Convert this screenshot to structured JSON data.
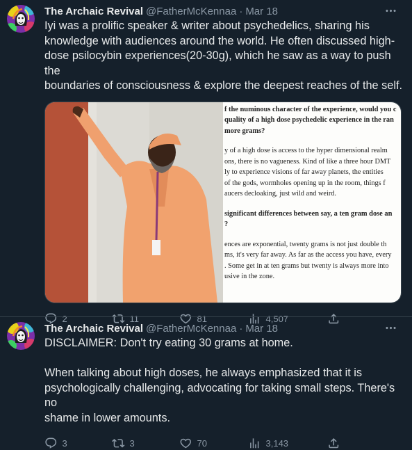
{
  "tweets": [
    {
      "author_name": "The Archaic Revival",
      "handle": "@FatherMcKennaa",
      "separator": "·",
      "date": "Mar 18",
      "text": "Iyi was a prolific speaker & writer about psychedelics, sharing his\nknowledge with audiences around the world. He often discussed high-\ndose psilocybin experiences(20-30g), which he saw as a way to push the\nboundaries of consciousness & explore the deepest reaches of the self.",
      "media": {
        "article_lines": [
          {
            "t": "f the numinous character of the experience, would you c",
            "b": true
          },
          {
            "t": "quality of a high dose psychedelic experience in the ran",
            "b": true
          },
          {
            "t": "more grams?",
            "b": true
          },
          {
            "t": "",
            "gap": true
          },
          {
            "t": "y of a high dose is access to the hyper dimensional realm",
            "b": false
          },
          {
            "t": "ons, there is no vagueness. Kind of like a three hour DMT",
            "b": false
          },
          {
            "t": "ly to experience visions of far away planets, the entities",
            "b": false
          },
          {
            "t": "of the gods, wormholes opening up in the room, things f",
            "b": false
          },
          {
            "t": "aucers decloaking, just wild and weird.",
            "b": false
          },
          {
            "t": "",
            "gap": true
          },
          {
            "t": "significant differences between say, a ten gram dose an",
            "b": true
          },
          {
            "t": "?",
            "b": true
          },
          {
            "t": "",
            "gap": true
          },
          {
            "t": "ences are exponential, twenty grams is not just double th",
            "b": false
          },
          {
            "t": "ms, it's very far away. As far as the access you have, every",
            "b": false
          },
          {
            "t": ". Some get in at ten grams but twenty is always more into",
            "b": false
          },
          {
            "t": "usive in the zone.",
            "b": false
          }
        ]
      },
      "stats": {
        "replies": "2",
        "reposts": "11",
        "likes": "81",
        "views": "4,507"
      }
    },
    {
      "author_name": "The Archaic Revival",
      "handle": "@FatherMcKennaa",
      "separator": "·",
      "date": "Mar 18",
      "text": "DISCLAIMER: Don't try eating 30 grams at home.\n\nWhen talking about high doses, he always emphasized that it is\npsychologically challenging, advocating for taking small steps. There's no\nshame in lower amounts.",
      "stats": {
        "replies": "3",
        "reposts": "3",
        "likes": "70",
        "views": "3,143"
      }
    }
  ],
  "colors": {
    "background": "#15202b",
    "text": "#e7e9ea",
    "muted": "#8b98a5",
    "border": "#38444d"
  }
}
